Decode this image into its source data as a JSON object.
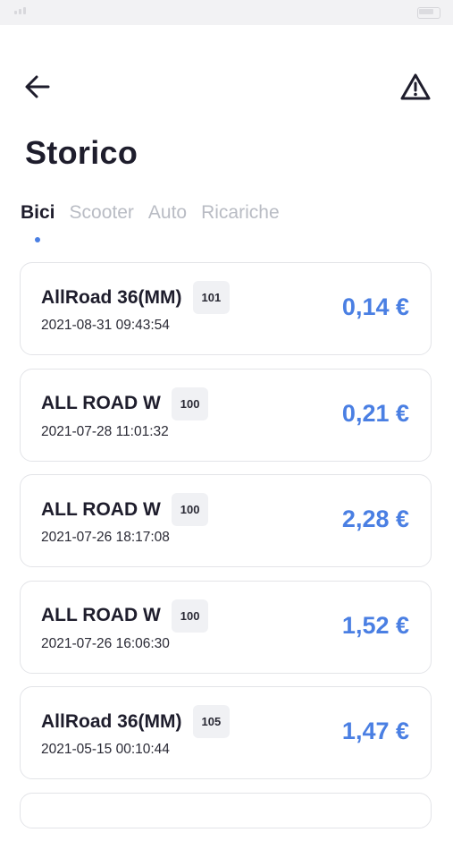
{
  "header": {
    "title": "Storico"
  },
  "tabs": [
    {
      "label": "Bici",
      "active": true
    },
    {
      "label": "Scooter",
      "active": false
    },
    {
      "label": "Auto",
      "active": false
    },
    {
      "label": "Ricariche",
      "active": false
    }
  ],
  "trips": [
    {
      "name": "AllRoad 36(MM)",
      "code": "101",
      "date": "2021-08-31 09:43:54",
      "price": "0,14 €"
    },
    {
      "name": "ALL ROAD W",
      "code": "100",
      "date": "2021-07-28 11:01:32",
      "price": "0,21 €"
    },
    {
      "name": "ALL ROAD W",
      "code": "100",
      "date": "2021-07-26 18:17:08",
      "price": "2,28 €"
    },
    {
      "name": "ALL ROAD W",
      "code": "100",
      "date": "2021-07-26 16:06:30",
      "price": "1,52 €"
    },
    {
      "name": "AllRoad 36(MM)",
      "code": "105",
      "date": "2021-05-15 00:10:44",
      "price": "1,47 €"
    }
  ],
  "colors": {
    "accent": "#4a7fe3",
    "text": "#1e1d2c",
    "inactive_tab": "#b9bcc4",
    "card_border": "#e3e4e8"
  },
  "icons": {
    "back": "arrow-left-icon",
    "alert": "warning-triangle-icon"
  }
}
